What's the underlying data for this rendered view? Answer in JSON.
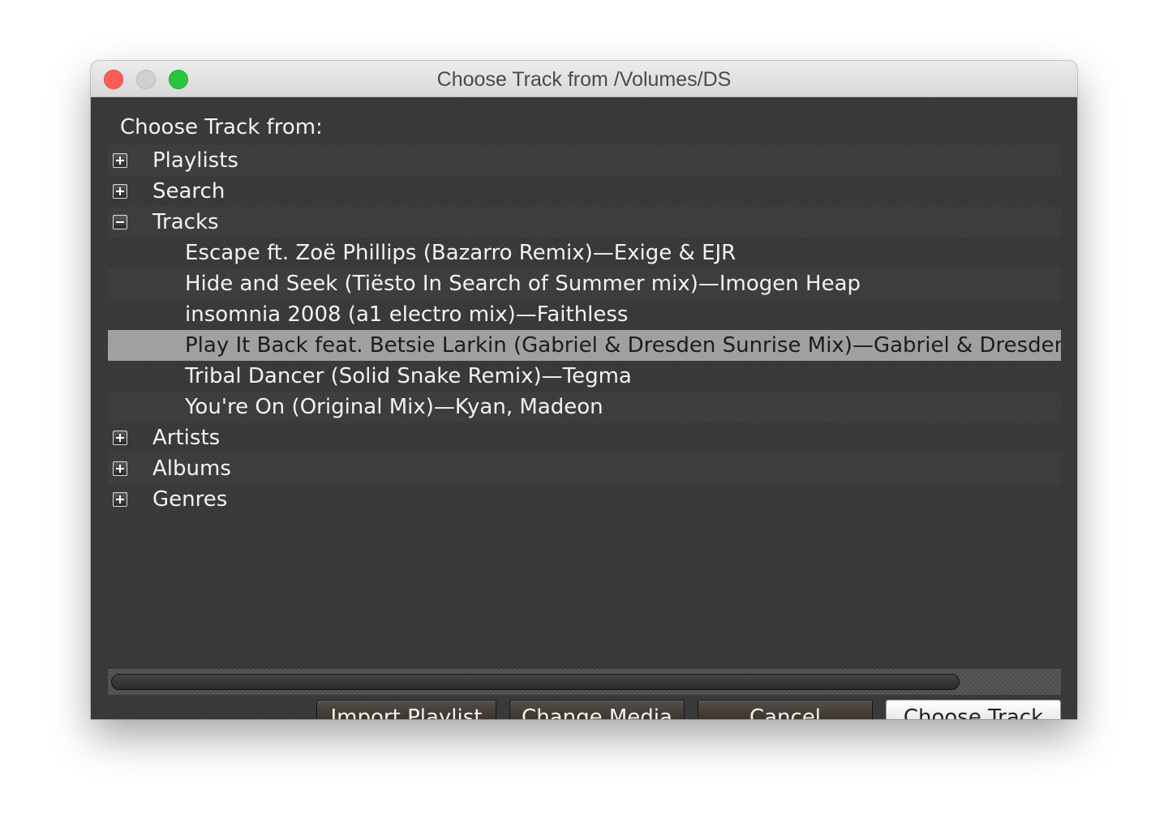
{
  "window": {
    "title": "Choose Track from /Volumes/DS"
  },
  "tree": {
    "heading": "Choose Track from:",
    "rows": [
      {
        "label": "Playlists",
        "kind": "group",
        "expanded": false
      },
      {
        "label": "Search",
        "kind": "group",
        "expanded": false
      },
      {
        "label": "Tracks",
        "kind": "group",
        "expanded": true
      },
      {
        "label": "Escape ft. Zoë Phillips (Bazarro Remix)—Exige & EJR",
        "kind": "track"
      },
      {
        "label": "Hide and Seek (Tiësto In Search of Summer mix)—Imogen Heap",
        "kind": "track"
      },
      {
        "label": "insomnia 2008 (a1 electro mix)—Faithless",
        "kind": "track"
      },
      {
        "label": "Play It Back feat. Betsie Larkin (Gabriel & Dresden Sunrise Mix)—Gabriel & Dresden, Betsie Larkin",
        "kind": "track",
        "selected": true
      },
      {
        "label": "Tribal Dancer (Solid Snake Remix)—Tegma",
        "kind": "track"
      },
      {
        "label": "You're On (Original Mix)—Kyan, Madeon",
        "kind": "track"
      },
      {
        "label": "Artists",
        "kind": "group",
        "expanded": false
      },
      {
        "label": "Albums",
        "kind": "group",
        "expanded": false
      },
      {
        "label": "Genres",
        "kind": "group",
        "expanded": false
      }
    ]
  },
  "buttons": {
    "import_playlist": "Import Playlist",
    "change_media": "Change Media",
    "cancel": "Cancel",
    "choose_track": "Choose Track"
  },
  "colors": {
    "selection": "#a0a0a0",
    "panel_bg": "#383838",
    "close": "#fc5e57",
    "zoom": "#2bc53f"
  }
}
